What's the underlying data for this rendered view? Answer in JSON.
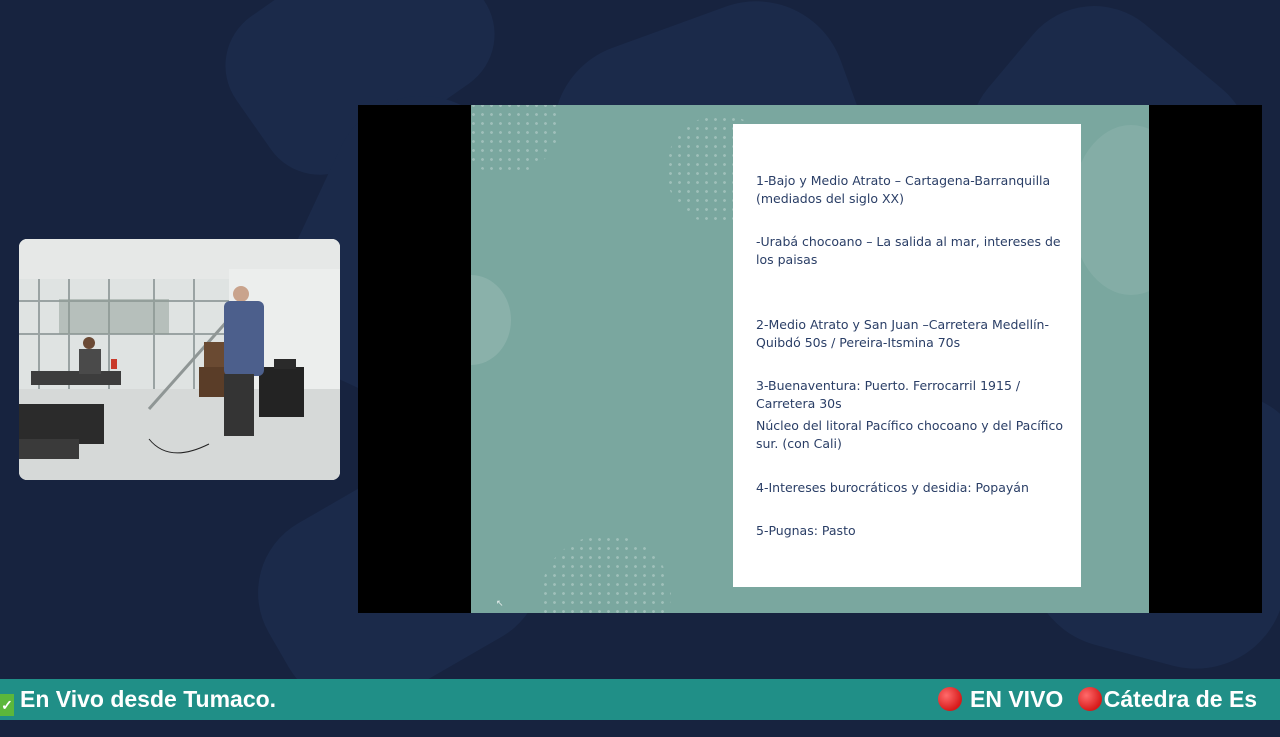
{
  "colors": {
    "background": "#17233f",
    "slide_bg": "#7aa79f",
    "slide_text": "#2a3e66",
    "ticker_bg": "#208f87"
  },
  "slide": {
    "items": [
      "1-Bajo y Medio Atrato – Cartagena-Barranquilla (mediados del siglo XX)",
      "-Urabá chocoano – La salida al mar, intereses de los paisas",
      "2-Medio Atrato y San Juan –Carretera Medellín-Quibdó  50s / Pereira-Itsmina 70s",
      "3-Buenaventura: Puerto. Ferrocarril 1915 / Carretera 30s",
      "Núcleo del litoral Pacífico chocoano y del Pacífico sur. (con Cali)",
      "4-Intereses burocráticos y desidia: Popayán",
      "5-Pugnas: Pasto"
    ]
  },
  "ticker": {
    "left_icon": "check-mark-icon",
    "left_text": "En Vivo desde Tumaco.",
    "live_icon": "red-circle-icon",
    "live_text": "EN VIVO",
    "right_text": "Cátedra de Es"
  }
}
